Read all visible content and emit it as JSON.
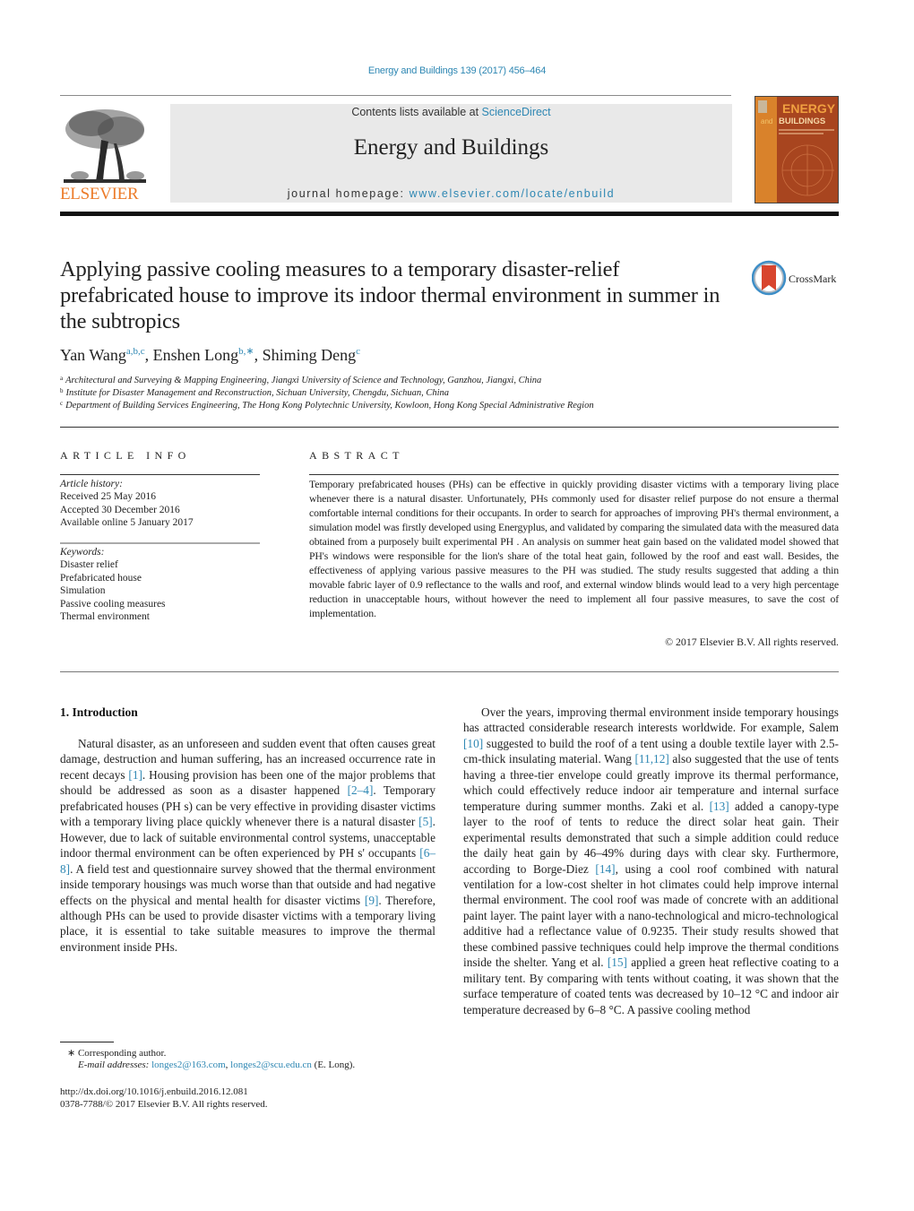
{
  "running_header": "Energy and Buildings 139 (2017) 456–464",
  "masthead": {
    "publisher_logo_text": "ELSEVIER",
    "contents_prefix": "Contents lists available at ",
    "contents_link": "ScienceDirect",
    "journal_title": "Energy and Buildings",
    "homepage_prefix": "journal homepage: ",
    "homepage_link": "www.elsevier.com/locate/enbuild",
    "cover": {
      "word1": "ENERGY",
      "word2_prefix": "and",
      "word2": "BUILDINGS"
    },
    "colors": {
      "elsevier_orange": "#ec7c2b",
      "link_blue": "#2e87b3",
      "cover_orange": "#d9822b",
      "cover_rust": "#a8451f"
    }
  },
  "article": {
    "title": "Applying passive cooling measures to a temporary disaster-relief prefabricated house to improve its indoor thermal environment in summer in the subtropics",
    "crossmark_label": "CrossMark",
    "authors": [
      {
        "name": "Yan Wang",
        "sup": "a,b,c"
      },
      {
        "name": "Enshen Long",
        "sup": "b,∗"
      },
      {
        "name": "Shiming Deng",
        "sup": "c"
      }
    ],
    "affiliations": [
      {
        "key": "a",
        "text": "Architectural and Surveying & Mapping Engineering, Jiangxi University of Science and Technology, Ganzhou, Jiangxi, China"
      },
      {
        "key": "b",
        "text": "Institute for Disaster Management and Reconstruction, Sichuan University, Chengdu, Sichuan, China"
      },
      {
        "key": "c",
        "text": "Department of Building Services Engineering, The Hong Kong Polytechnic University, Kowloon, Hong Kong Special Administrative Region"
      }
    ]
  },
  "article_info": {
    "heading": "ARTICLE INFO",
    "history_label": "Article history:",
    "history": [
      "Received 25 May 2016",
      "Accepted 30 December 2016",
      "Available online 5 January 2017"
    ],
    "keywords_label": "Keywords:",
    "keywords": [
      "Disaster relief",
      "Prefabricated house",
      "Simulation",
      "Passive cooling measures",
      "Thermal environment"
    ]
  },
  "abstract": {
    "heading": "ABSTRACT",
    "body": "Temporary prefabricated houses (PHs) can be effective in quickly providing disaster victims with a temporary living place whenever there is a natural disaster. Unfortunately, PHs commonly used for disaster relief purpose do not ensure a thermal comfortable internal conditions for their occupants. In order to search for approaches of improving PH's thermal environment, a simulation model was firstly developed using Energyplus, and validated by comparing the simulated data with the measured data obtained from a purposely built experimental PH . An analysis on summer heat gain based on the validated model showed that PH's windows were responsible for the lion's share of the total heat gain, followed by the roof and east wall. Besides, the effectiveness of applying various passive measures to the PH was studied. The study results suggested that adding a thin movable fabric layer of 0.9 reflectance to the walls and roof, and external window blinds would lead to a very high percentage reduction in unacceptable hours, without however the need to implement all four passive measures, to save the cost of implementation.",
    "copyright": "© 2017 Elsevier B.V. All rights reserved."
  },
  "body": {
    "section_heading": "1.  Introduction",
    "left_paragraph": [
      {
        "t": "Natural disaster, as an unforeseen and sudden event that often causes great damage, destruction and human suffering, has an increased occurrence rate in recent decays "
      },
      {
        "ref": "[1]"
      },
      {
        "t": ". Housing provision has been one of the major problems that should be addressed as soon as a disaster happened "
      },
      {
        "ref": "[2–4]"
      },
      {
        "t": ". Temporary prefabricated houses (PH s) can be very effective in providing disaster victims with a temporary living place quickly whenever there is a natural disaster "
      },
      {
        "ref": "[5]"
      },
      {
        "t": ". However, due to lack of suitable environmental control systems, unacceptable indoor thermal environment can be often experienced by PH s' occupants "
      },
      {
        "ref": "[6–8]"
      },
      {
        "t": ". A field test and questionnaire survey showed that the thermal environment inside temporary housings was much worse than that outside and had negative effects on the physical and mental health for disaster victims "
      },
      {
        "ref": "[9]"
      },
      {
        "t": ". Therefore, although PHs can be used to provide disaster victims with a temporary living place, it is essential to take suitable measures to improve the thermal environment inside PHs."
      }
    ],
    "right_paragraph": [
      {
        "t": "Over the years, improving thermal environment inside temporary housings has attracted considerable research interests worldwide. For example, Salem "
      },
      {
        "ref": "[10]"
      },
      {
        "t": " suggested to build the roof of a tent using a double textile layer with 2.5-cm-thick insulating material. Wang "
      },
      {
        "ref": "[11,12]"
      },
      {
        "t": " also suggested that the use of tents having a three-tier envelope could greatly improve its thermal performance, which could effectively reduce indoor air temperature and internal surface temperature during summer months. Zaki et al. "
      },
      {
        "ref": "[13]"
      },
      {
        "t": " added a canopy-type layer to the roof of tents to reduce the direct solar heat gain. Their experimental results demonstrated that such a simple addition could reduce the daily heat gain by 46–49% during days with clear sky. Furthermore, according to Borge-Diez "
      },
      {
        "ref": "[14]"
      },
      {
        "t": ", using a cool roof combined with natural ventilation for a low-cost shelter in hot climates could help improve internal thermal environment. The cool roof was made of concrete with an additional paint layer. The paint layer with a nano-technological and micro-technological additive had a reflectance value of 0.9235. Their study results showed that these combined passive techniques could help improve the thermal conditions inside the shelter. Yang et al. "
      },
      {
        "ref": "[15]"
      },
      {
        "t": " applied a green heat reflective coating to a military tent. By comparing with tents without coating, it was shown that the surface temperature of coated tents was decreased by 10–12 °C and indoor air temperature decreased by 6–8 °C. A passive cooling method"
      }
    ]
  },
  "footnotes": {
    "corresponding_mark": "∗",
    "corresponding_text": "Corresponding author.",
    "email_label": "E-mail addresses:",
    "emails": [
      "longes2@163.com",
      "longes2@scu.edu.cn"
    ],
    "email_suffix": " (E. Long).",
    "doi": "http://dx.doi.org/10.1016/j.enbuild.2016.12.081",
    "issn_line": "0378-7788/© 2017 Elsevier B.V. All rights reserved."
  }
}
